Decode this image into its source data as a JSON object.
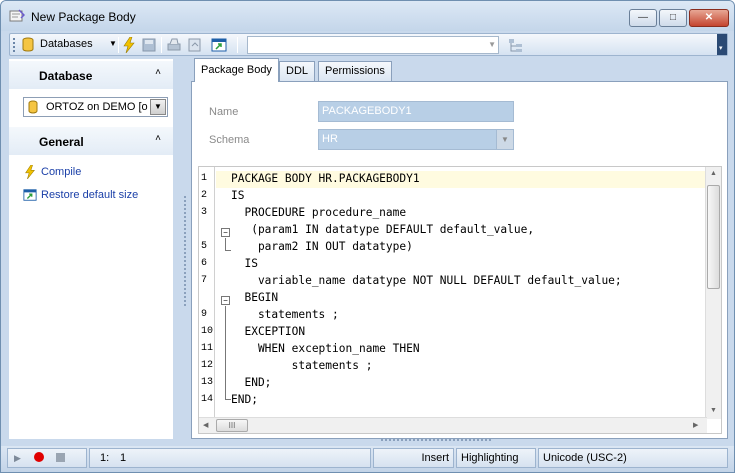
{
  "window": {
    "title": "New Package Body",
    "minimize": "—",
    "maximize": "□",
    "close": "✕"
  },
  "toolbar": {
    "databases_label": "Databases",
    "dropdown_arrow": "▼",
    "combo_arrow": "▼",
    "overflow": "▾"
  },
  "left": {
    "database_header": "Database",
    "collapse": "˄",
    "database_value": "ORTOZ on DEMO [o",
    "general_header": "General",
    "tasks": [
      "Compile",
      "Restore default size"
    ]
  },
  "tabs": [
    "Package Body",
    "DDL",
    "Permissions"
  ],
  "form": {
    "name_label": "Name",
    "name_value": "PACKAGEBODY1",
    "schema_label": "Schema",
    "schema_value": "HR"
  },
  "editor": {
    "line_numbers": [
      "1",
      "2",
      "3",
      "",
      "5",
      "6",
      "7",
      "",
      "9",
      "10",
      "11",
      "12",
      "13",
      "14"
    ],
    "lines": [
      "PACKAGE BODY HR.PACKAGEBODY1",
      "IS",
      "  PROCEDURE procedure_name",
      "   (param1 IN datatype DEFAULT default_value,",
      "    param2 IN OUT datatype)",
      "  IS",
      "    variable_name datatype NOT NULL DEFAULT default_value;",
      "  BEGIN",
      "    statements ;",
      "  EXCEPTION",
      "    WHEN exception_name THEN",
      "         statements ;",
      "  END;",
      "END;"
    ],
    "hscroll_thumb": "III"
  },
  "status": {
    "position_line": "1:",
    "position_col": "1",
    "mode": "Insert",
    "highlighting": "Highlighting",
    "encoding": "Unicode (USC-2)"
  },
  "colors": {
    "title_gradient_top": "#dce8f5",
    "field_bg": "#b8cfe6",
    "current_line": "#fffbe0",
    "link": "#1a3fa8"
  }
}
